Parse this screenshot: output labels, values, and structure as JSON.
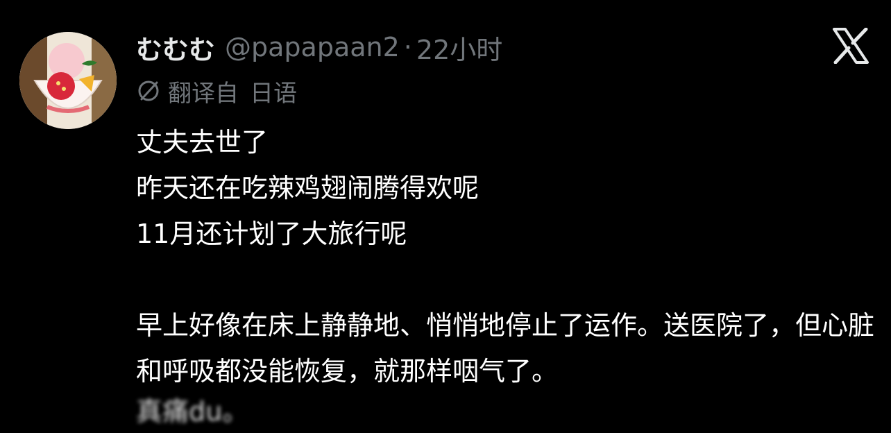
{
  "tweet": {
    "display_name": "むむむ",
    "handle": "@papapaan2",
    "separator": "·",
    "time": "22小时",
    "translated_from_label": "翻译自",
    "translated_from_lang": "日语",
    "lines": [
      "丈夫去世了",
      "昨天还在吃辣鸡翅闹腾得欢呢",
      "11月还计划了大旅行呢"
    ],
    "paragraph": "早上好像在床上静静地、悄悄地停止了运作。送医院了，但心脏和呼吸都没能恢复，就那样咽气了。",
    "cutoff_line": "真痛du。"
  },
  "icons": {
    "close": "x-logo-icon",
    "translate": "translate-icon"
  },
  "colors": {
    "background": "#000000",
    "text_primary": "#ffffff",
    "text_secondary": "#71767b"
  }
}
